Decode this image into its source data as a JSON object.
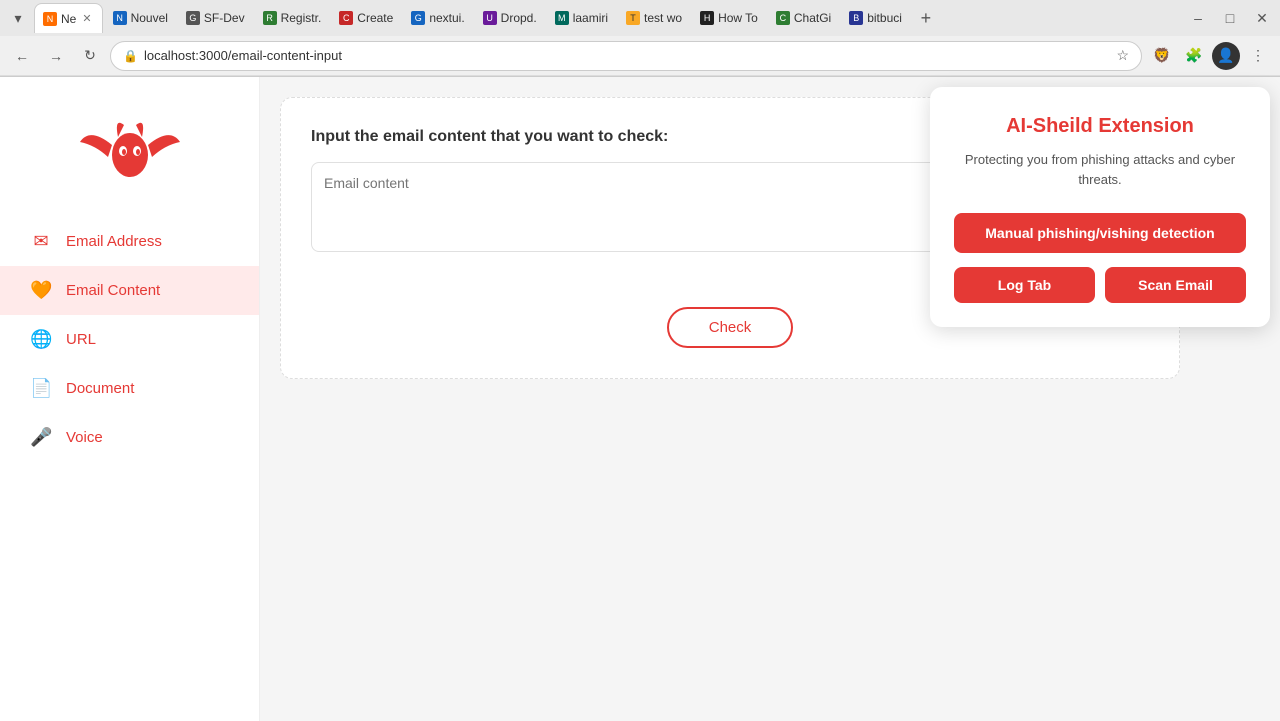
{
  "browser": {
    "url": "localhost:3000/email-content-input",
    "tabs": [
      {
        "id": "t1",
        "label": "Ne",
        "active": true,
        "favicon_color": "fav-orange",
        "favicon_char": "N"
      },
      {
        "id": "t2",
        "label": "Nouvel",
        "active": false,
        "favicon_color": "fav-blue",
        "favicon_char": "N"
      },
      {
        "id": "t3",
        "label": "SF-Dev",
        "active": false,
        "favicon_color": "fav-gray",
        "favicon_char": "G"
      },
      {
        "id": "t4",
        "label": "Registr.",
        "active": false,
        "favicon_color": "fav-green",
        "favicon_char": "R"
      },
      {
        "id": "t5",
        "label": "Create",
        "active": false,
        "favicon_color": "fav-red",
        "favicon_char": "C"
      },
      {
        "id": "t6",
        "label": "nextui.",
        "active": false,
        "favicon_color": "fav-blue",
        "favicon_char": "G"
      },
      {
        "id": "t7",
        "label": "Dropd.",
        "active": false,
        "favicon_color": "fav-purple",
        "favicon_char": "U"
      },
      {
        "id": "t8",
        "label": "laamiri",
        "active": false,
        "favicon_color": "fav-teal",
        "favicon_char": "M"
      },
      {
        "id": "t9",
        "label": "test wo",
        "active": false,
        "favicon_color": "fav-yellow",
        "favicon_char": "T"
      },
      {
        "id": "t10",
        "label": "How To",
        "active": false,
        "favicon_color": "fav-dark",
        "favicon_char": "H"
      },
      {
        "id": "t11",
        "label": "ChatGi",
        "active": false,
        "favicon_color": "fav-green",
        "favicon_char": "C"
      },
      {
        "id": "t12",
        "label": "bitbuci",
        "active": false,
        "favicon_color": "fav-indigo",
        "favicon_char": "B"
      }
    ],
    "window_controls": {
      "minimize": "–",
      "maximize": "□",
      "close": "✕"
    }
  },
  "sidebar": {
    "items": [
      {
        "id": "email-address",
        "label": "Email Address",
        "icon": "✉"
      },
      {
        "id": "email-content",
        "label": "Email Content",
        "icon": "💔"
      },
      {
        "id": "url",
        "label": "URL",
        "icon": "🌐"
      },
      {
        "id": "document",
        "label": "Document",
        "icon": "📄"
      },
      {
        "id": "voice",
        "label": "Voice",
        "icon": "🎤"
      }
    ]
  },
  "main": {
    "card": {
      "title": "Input the email content that you want to check:",
      "textarea_placeholder": "Email content",
      "check_button": "Check"
    }
  },
  "extension_popup": {
    "title": "AI-Sheild Extension",
    "subtitle": "Protecting you from phishing attacks and\ncyber threats.",
    "manual_btn": "Manual phishing/vishing detection",
    "log_tab_btn": "Log Tab",
    "scan_email_btn": "Scan Email"
  },
  "colors": {
    "primary": "#e53935",
    "primary_dark": "#c62828"
  }
}
